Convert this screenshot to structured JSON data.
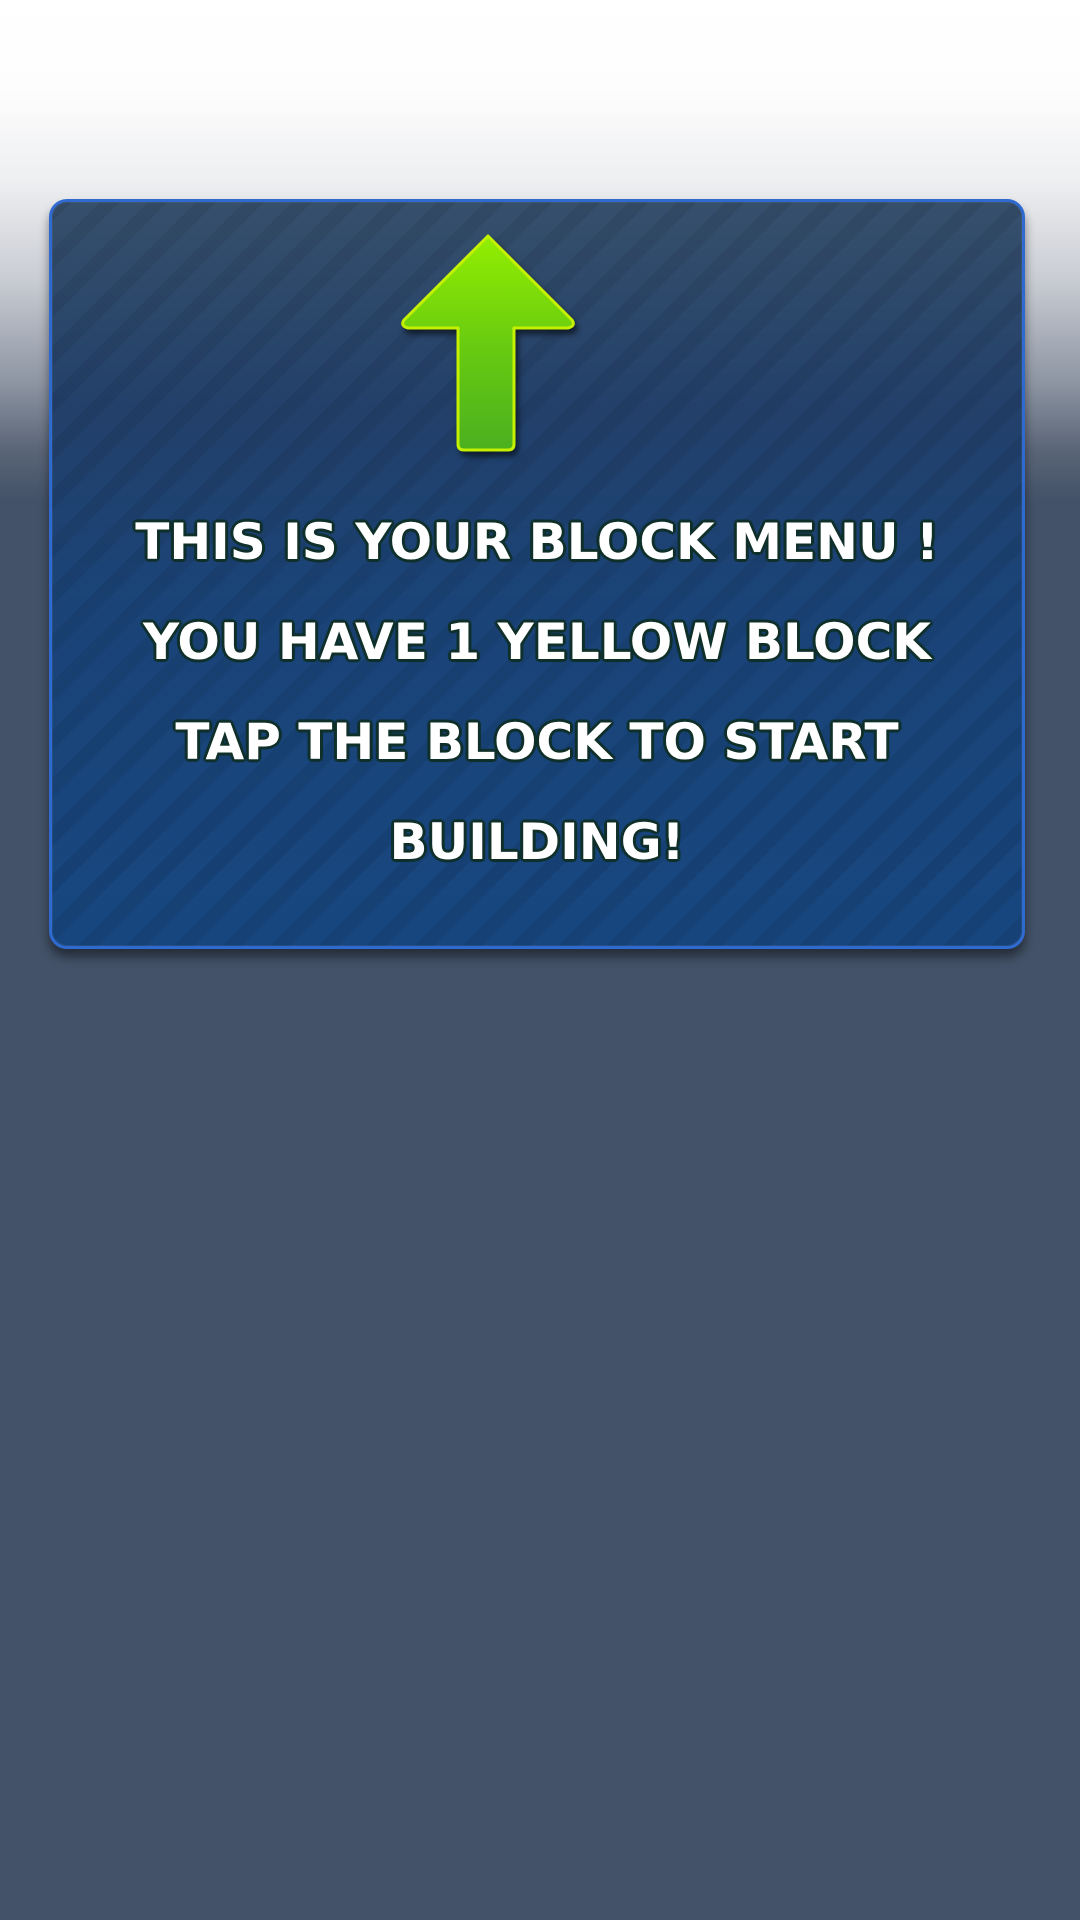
{
  "tutorial": {
    "lines": [
      "THIS IS YOUR BLOCK MENU !",
      "YOU HAVE 1 YELLOW BLOCK",
      "TAP THE BLOCK TO START",
      "BUILDING!"
    ],
    "arrow_icon": "up-arrow-icon"
  },
  "colors": {
    "panel_border": "#2f6ad0",
    "panel_fill": "#17467f",
    "arrow_green": "#6fd10a",
    "background": "#435268"
  }
}
